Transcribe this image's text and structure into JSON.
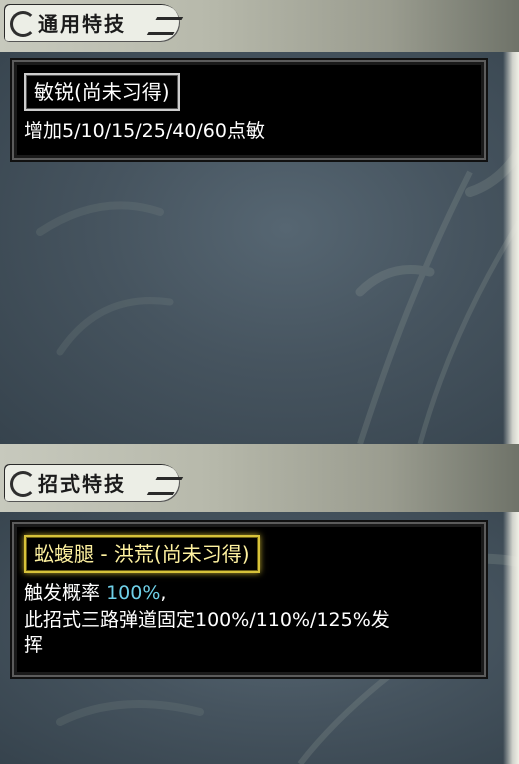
{
  "sections": [
    {
      "title": "通用特技",
      "skills": [
        {
          "name": "敏锐(尚未习得)",
          "description": "增加5/10/15/25/40/60点敏"
        }
      ]
    },
    {
      "title": "招式特技",
      "skills": [
        {
          "name": "蚣蝮腿 - 洪荒(尚未习得)",
          "trigger_label": "触发概率",
          "trigger_value": "100%",
          "trigger_suffix": ",",
          "effect_line1": "此招式三路弹道固定100%/110%/125%发",
          "effect_line2": "挥"
        }
      ]
    }
  ],
  "colors": {
    "highlight": "#6fd0e8",
    "gold_border": "#d7c23a"
  }
}
